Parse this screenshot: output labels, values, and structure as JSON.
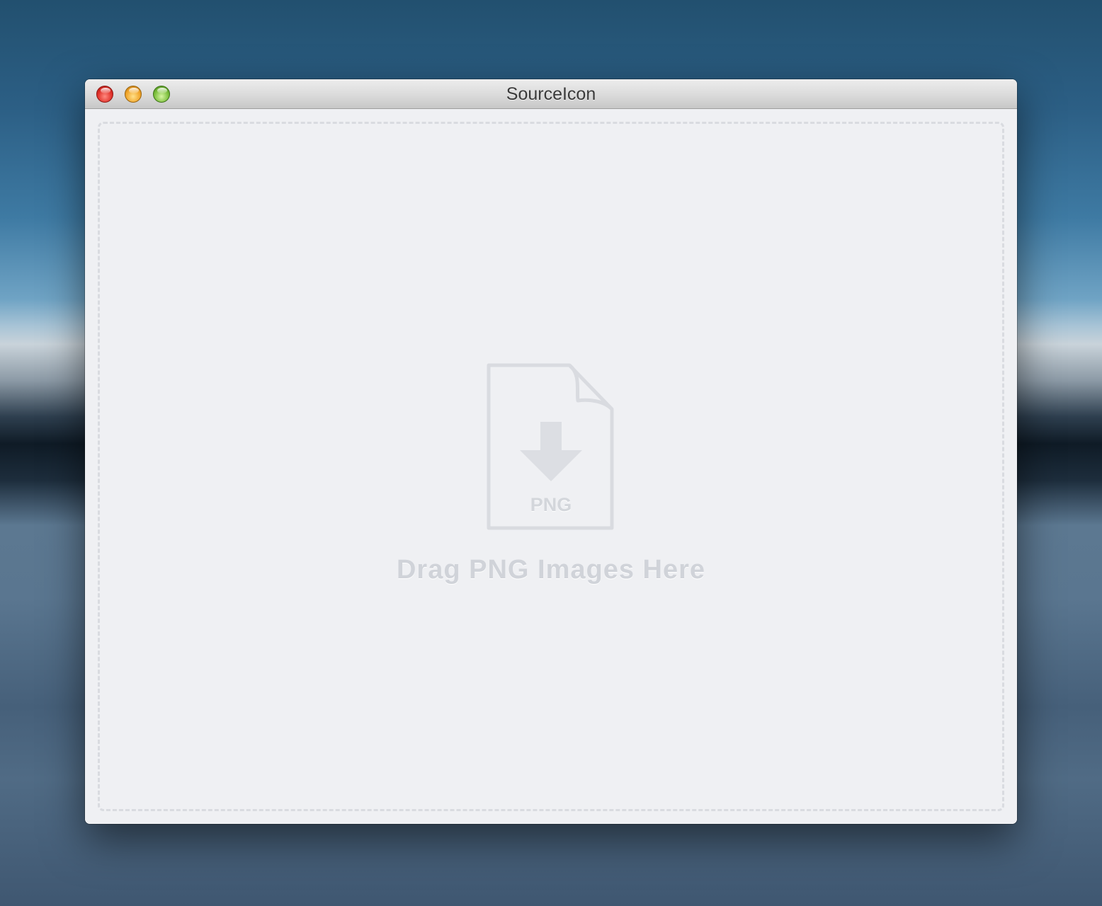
{
  "window": {
    "title": "SourceIcon",
    "buttons": {
      "close": "close-button",
      "minimize": "minimize-button",
      "zoom": "zoom-button"
    }
  },
  "dropzone": {
    "icon": "png-file-download-icon",
    "icon_label": "PNG",
    "instruction": "Drag PNG Images Here"
  },
  "colors": {
    "close": "#e0312a",
    "minimize": "#f1a52a",
    "zoom": "#7cbf3d",
    "content_background": "#eff0f3",
    "placeholder_graphic": "#d9dbe0"
  }
}
